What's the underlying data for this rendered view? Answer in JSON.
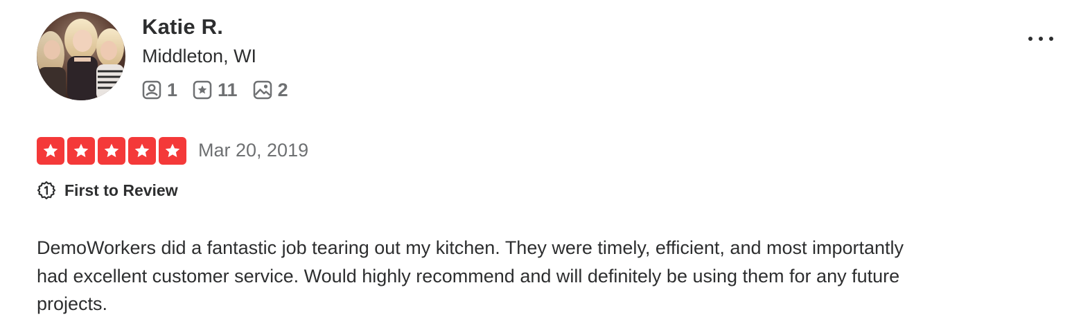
{
  "user": {
    "name": "Katie R.",
    "location": "Middleton, WI",
    "stats": {
      "friends": "1",
      "reviews": "11",
      "photos": "2"
    }
  },
  "review": {
    "rating": 5,
    "rating_max": 5,
    "date": "Mar 20, 2019",
    "badge": "First to Review",
    "text": "DemoWorkers did a fantastic job tearing out my kitchen. They were timely, efficient, and most importantly had excellent customer service. Would highly recommend and will definitely be using them for any future projects."
  },
  "colors": {
    "star": "#f43939",
    "text": "#2d2e2f",
    "muted": "#6e7072"
  },
  "icons": {
    "friends": "friends-icon",
    "reviews": "review-star-icon",
    "photos": "photo-icon",
    "more": "more-dots-icon",
    "badge": "first-to-review-icon",
    "star": "star-icon"
  }
}
